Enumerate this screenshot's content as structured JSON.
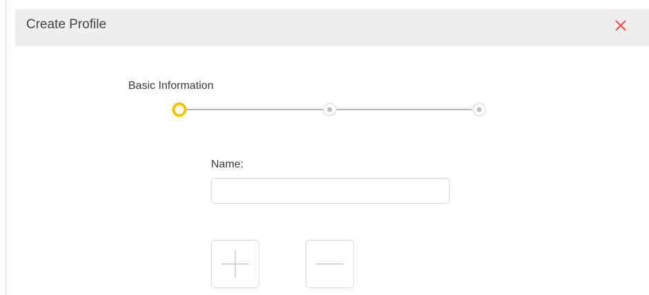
{
  "dialog": {
    "title": "Create Profile",
    "close_icon": "close-icon",
    "accent_color": "#f5c400",
    "close_color": "#f04b4b"
  },
  "stepper": {
    "current_step_label": "Basic Information",
    "steps": [
      {
        "state": "active"
      },
      {
        "state": "inactive"
      },
      {
        "state": "inactive"
      }
    ]
  },
  "form": {
    "name_label": "Name:",
    "name_value": "",
    "name_placeholder": ""
  },
  "actions": {
    "add_icon": "plus-icon",
    "remove_icon": "minus-icon"
  }
}
